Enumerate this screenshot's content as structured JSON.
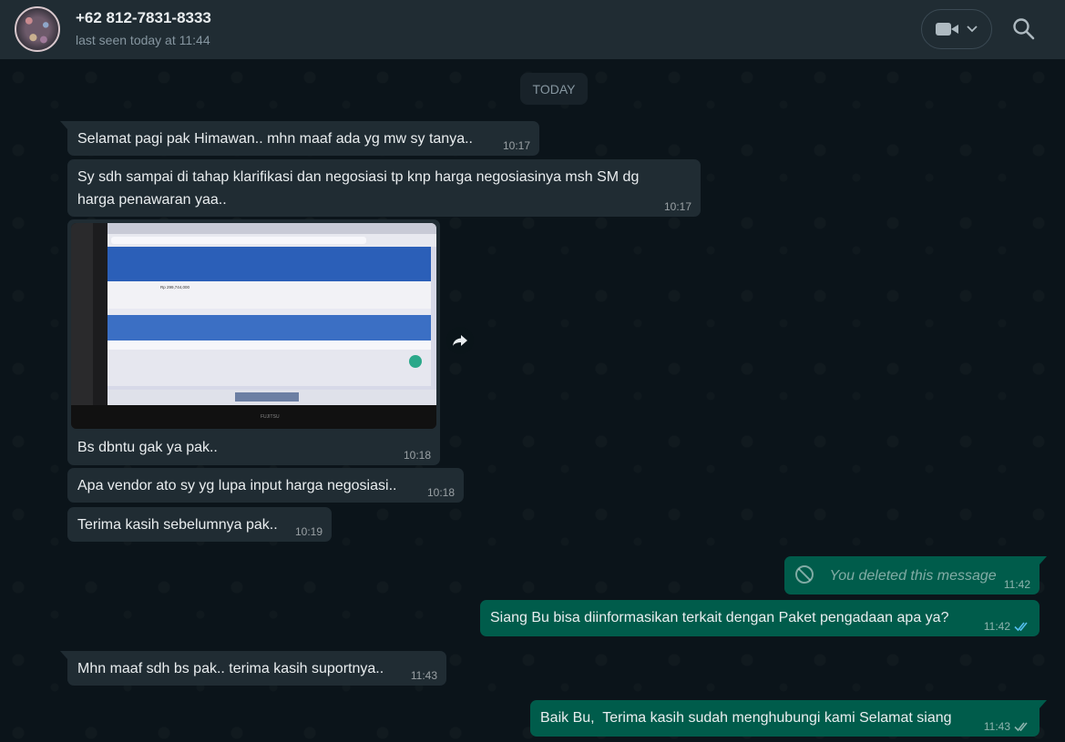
{
  "header": {
    "contact_name": "+62 812-7831-8333",
    "status": "last seen today at 11:44",
    "video_icon": "video-camera-icon",
    "dropdown_icon": "chevron-down-icon",
    "search_icon": "search-icon"
  },
  "chat": {
    "date_divider": "TODAY",
    "messages": [
      {
        "direction": "in",
        "text": "Selamat pagi pak Himawan.. mhn maaf ada yg mw sy tanya..",
        "time": "10:17"
      },
      {
        "direction": "in",
        "text_line1": "Sy sdh sampai di tahap klarifikasi dan negosiasi tp knp harga negosiasinya msh SM dg",
        "text_line2": "harga penawaran yaa..",
        "time": "10:17"
      },
      {
        "direction": "in",
        "type": "image",
        "caption": "Bs dbntu gak ya pak..",
        "time": "10:18",
        "photo_brand": "FUJITSU",
        "photo_price": "Rp 299,744,000"
      },
      {
        "direction": "in",
        "text": "Apa vendor ato sy yg lupa input harga negosiasi..",
        "time": "10:18"
      },
      {
        "direction": "in",
        "text": "Terima kasih sebelumnya pak..",
        "time": "10:19"
      },
      {
        "direction": "out",
        "deleted": true,
        "text": "You deleted this message",
        "time": "11:42"
      },
      {
        "direction": "out",
        "text": "Siang Bu bisa diinformasikan terkait dengan Paket pengadaan apa ya?",
        "time": "11:42",
        "status": "read"
      },
      {
        "direction": "in",
        "text": "Mhn maaf sdh bs pak.. terima kasih suportnya..",
        "time": "11:43"
      },
      {
        "direction": "out",
        "text": "Baik Bu,  Terima kasih sudah menghubungi kami Selamat siang",
        "time": "11:43",
        "status": "delivered"
      }
    ]
  },
  "colors": {
    "header_bg": "#202c33",
    "chat_bg": "#0b141a",
    "incoming_bubble": "#202c33",
    "outgoing_bubble": "#005c4b",
    "read_tick": "#53bdeb"
  }
}
